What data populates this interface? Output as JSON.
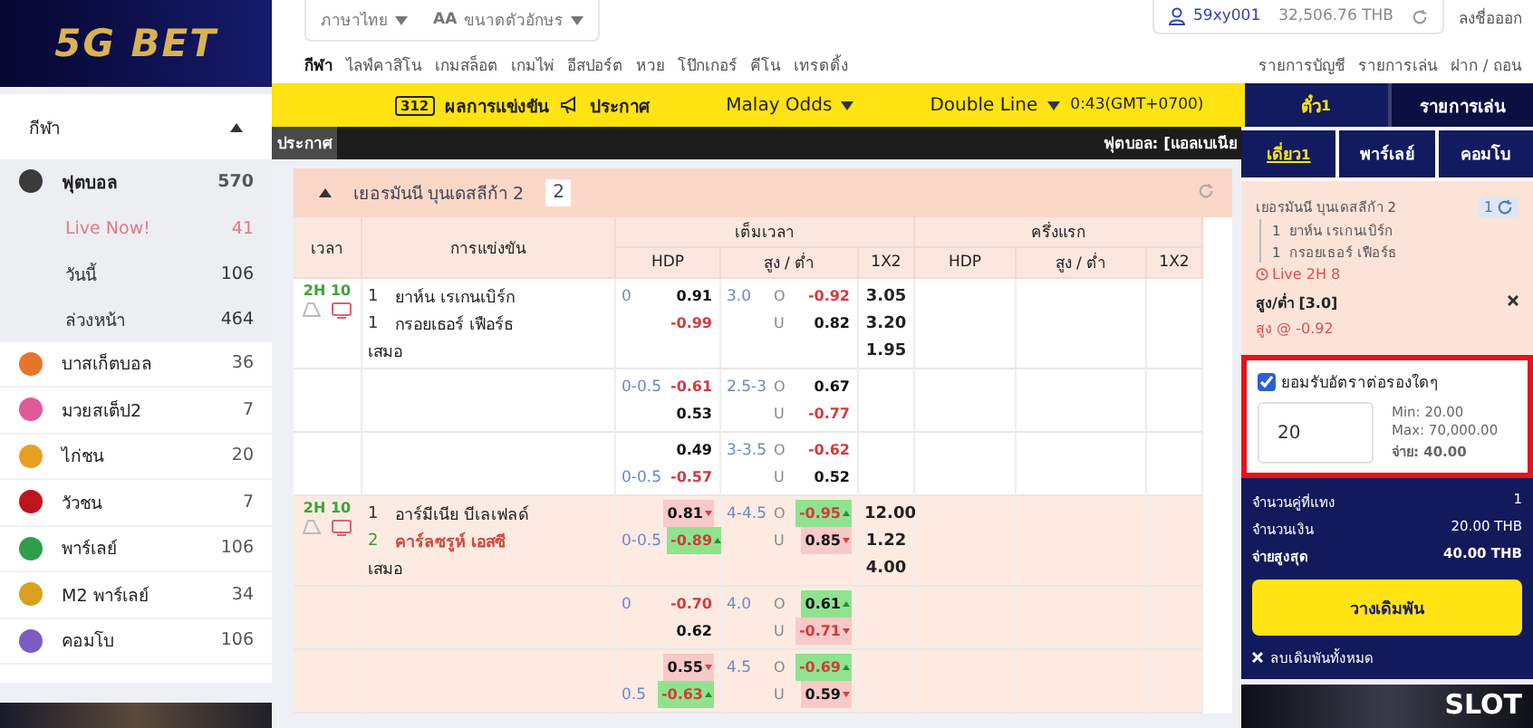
{
  "sidebar": {
    "logo": "5G BET",
    "section": {
      "label": "กีฬา",
      "expanded": true
    },
    "items": [
      {
        "label": "ฟุตบอล",
        "count": "570",
        "color": "#3a3a3a",
        "expanded": true,
        "children": [
          {
            "label": "Live Now!",
            "count": "41",
            "live": true
          },
          {
            "label": "วันนี้",
            "count": "106",
            "live": false
          },
          {
            "label": "ล่วงหน้า",
            "count": "464",
            "live": false
          }
        ]
      },
      {
        "label": "บาสเก็ตบอล",
        "count": "36",
        "color": "#e8742c",
        "expanded": false
      },
      {
        "label": "มวยสเต็ป2",
        "count": "7",
        "color": "#e05a9a",
        "expanded": false
      },
      {
        "label": "ไก่ชน",
        "count": "20",
        "color": "#e8a020",
        "expanded": false
      },
      {
        "label": "วัวชน",
        "count": "7",
        "color": "#c0141c",
        "expanded": false
      },
      {
        "label": "พาร์เลย์",
        "count": "106",
        "color": "#2e9e4a",
        "expanded": false
      },
      {
        "label": "M2 พาร์เลย์",
        "count": "34",
        "color": "#d9a020",
        "expanded": false
      },
      {
        "label": "คอมโบ",
        "count": "106",
        "color": "#7b5cc4",
        "expanded": false
      }
    ]
  },
  "header": {
    "language": "ภาษาไทย",
    "font_size": {
      "icon": "AA",
      "label": "ขนาดตัวอักษร"
    },
    "user": "59xy001",
    "balance": "32,506.76 THB",
    "logout": "ลงชื่อออก",
    "nav": [
      {
        "label": "กีฬา",
        "selected": true
      },
      {
        "label": "ไลฟ์คาสิโน",
        "selected": false
      },
      {
        "label": "เกมสล็อต",
        "selected": false
      },
      {
        "label": "เกมไพ่",
        "selected": false
      },
      {
        "label": "อีสปอร์ต",
        "selected": false
      },
      {
        "label": "หวย",
        "selected": false
      },
      {
        "label": "โป๊กเกอร์",
        "selected": false
      },
      {
        "label": "คีโน",
        "selected": false
      },
      {
        "label": "เทรดดิ้ง",
        "selected": false
      }
    ],
    "account_links": [
      "รายการบัญชี",
      "รายการเล่น",
      "ฝาก / ถอน"
    ]
  },
  "toolbar": {
    "results_count": "312",
    "results": "ผลการแข่งขัน",
    "announcements": "ประกาศ",
    "odds_type": "Malay Odds",
    "line_mode": "Double Line",
    "clock": "0:43(GMT+0700)"
  },
  "marquee": {
    "label": "ประกาศ",
    "text": "ฟุตบอล: [แอลเบเนีย"
  },
  "league": {
    "name": "เยอรมันนี บุนเดสลีก้า 2",
    "count": "2",
    "expanded": true,
    "columns": {
      "time": "เวลา",
      "match": "การแข่งขัน",
      "groups": [
        {
          "label": "เต็มเวลา",
          "cols": [
            "HDP",
            "สูง / ต่ำ",
            "1X2"
          ]
        },
        {
          "label": "ครึ่งแรก",
          "cols": [
            "HDP",
            "สูง / ต่ำ",
            "1X2"
          ]
        }
      ]
    },
    "matches": [
      {
        "time": "2H 10",
        "highlighted": false,
        "teams": [
          {
            "num": "1",
            "name": "ยาห์น เรเกนเบิร์ก",
            "favored": false
          },
          {
            "num": "1",
            "name": "กรอยเธอร์ เฟือร์ธ",
            "favored": false
          }
        ],
        "draw": "เสมอ",
        "lines": [
          {
            "hdp": {
              "home_line": "0",
              "home": {
                "v": "0.91",
                "neg": false
              },
              "away": {
                "v": "-0.99",
                "neg": true
              }
            },
            "ou": {
              "line": "3.0",
              "o": "O",
              "over": {
                "v": "-0.92",
                "neg": true
              },
              "u": "U",
              "under": {
                "v": "0.82",
                "neg": false
              }
            },
            "x12": [
              "3.05",
              "3.20",
              "1.95"
            ]
          },
          {
            "hdp": {
              "home_line": "0-0.5",
              "home": {
                "v": "-0.61",
                "neg": true
              },
              "away": {
                "v": "0.53",
                "neg": false
              }
            },
            "ou": {
              "line": "2.5-3",
              "o": "O",
              "over": {
                "v": "0.67",
                "neg": false
              },
              "u": "U",
              "under": {
                "v": "-0.77",
                "neg": true
              }
            }
          },
          {
            "hdp": {
              "home": {
                "v": "0.49",
                "neg": false
              },
              "away_line": "0-0.5",
              "away": {
                "v": "-0.57",
                "neg": true
              }
            },
            "ou": {
              "line": "3-3.5",
              "o": "O",
              "over": {
                "v": "-0.62",
                "neg": true
              },
              "u": "U",
              "under": {
                "v": "0.52",
                "neg": false
              }
            }
          }
        ]
      },
      {
        "time": "2H 10",
        "highlighted": true,
        "teams": [
          {
            "num": "1",
            "name": "อาร์มีเนีย บีเลเฟลด์",
            "favored": false
          },
          {
            "num": "2",
            "name": "คาร์ลซรูห์ เอสซี",
            "favored": true
          }
        ],
        "draw": "เสมอ",
        "lines": [
          {
            "hdp": {
              "home": {
                "v": "0.81",
                "neg": false,
                "falling": true
              },
              "away_line": "0-0.5",
              "away": {
                "v": "-0.89",
                "neg": true,
                "rising": true
              }
            },
            "ou": {
              "line": "4-4.5",
              "o": "O",
              "over": {
                "v": "-0.95",
                "neg": true,
                "rising": true
              },
              "u": "U",
              "under": {
                "v": "0.85",
                "neg": false,
                "falling": true
              }
            },
            "x12": [
              "12.00",
              "1.22",
              "4.00"
            ]
          },
          {
            "hdp": {
              "home_line": "0",
              "home": {
                "v": "-0.70",
                "neg": true
              },
              "away": {
                "v": "0.62",
                "neg": false
              }
            },
            "ou": {
              "line": "4.0",
              "o": "O",
              "over": {
                "v": "0.61",
                "neg": false,
                "rising": true
              },
              "u": "U",
              "under": {
                "v": "-0.71",
                "neg": true,
                "falling": true
              }
            }
          },
          {
            "hdp": {
              "home": {
                "v": "0.55",
                "neg": false,
                "falling": true
              },
              "away_line": "0.5",
              "away": {
                "v": "-0.63",
                "neg": true,
                "rising": true
              }
            },
            "ou": {
              "line": "4.5",
              "o": "O",
              "over": {
                "v": "-0.69",
                "neg": true,
                "rising": true
              },
              "u": "U",
              "under": {
                "v": "0.59",
                "neg": false,
                "falling": true
              }
            }
          }
        ]
      }
    ]
  },
  "betslip": {
    "tabs": [
      {
        "label": "ตั๋ว",
        "badge": "1",
        "selected": true
      },
      {
        "label": "รายการเล่น",
        "selected": false
      }
    ],
    "subtabs": [
      {
        "label": "เดี่ยว",
        "badge": "1",
        "selected": true
      },
      {
        "label": "พาร์เลย์",
        "selected": false
      },
      {
        "label": "คอมโบ",
        "selected": false
      }
    ],
    "ticket": {
      "league": "เยอรมันนี บุนเดสลีก้า 2",
      "count": "1",
      "teams": [
        {
          "num": "1",
          "name": "ยาห์น เรเกนเบิร์ก"
        },
        {
          "num": "1",
          "name": "กรอยเธอร์ เฟือร์ธ"
        }
      ],
      "live": "Live 2H 8",
      "market": "สูง/ต่ำ [3.0]",
      "pick": "สูง @ -0.92"
    },
    "accept": {
      "label": "ยอมรับอัตราต่อรองใดๆ",
      "checked": true
    },
    "stake": "20",
    "min": "Min: 20.00",
    "max": "Max: 70,000.00",
    "payout": {
      "label": "จ่าย:",
      "value": "40.00"
    },
    "summary": [
      {
        "label": "จำนวนคู่ที่แทง",
        "value": "1"
      },
      {
        "label": "จำนวนเงิน",
        "value": "20.00 THB"
      },
      {
        "label": "จ่ายสูงสุด",
        "value": "40.00 THB"
      }
    ],
    "place": "วางเดิมพัน",
    "clear": "ลบเดิมพันทั้งหมด",
    "banner": "SLOT"
  }
}
